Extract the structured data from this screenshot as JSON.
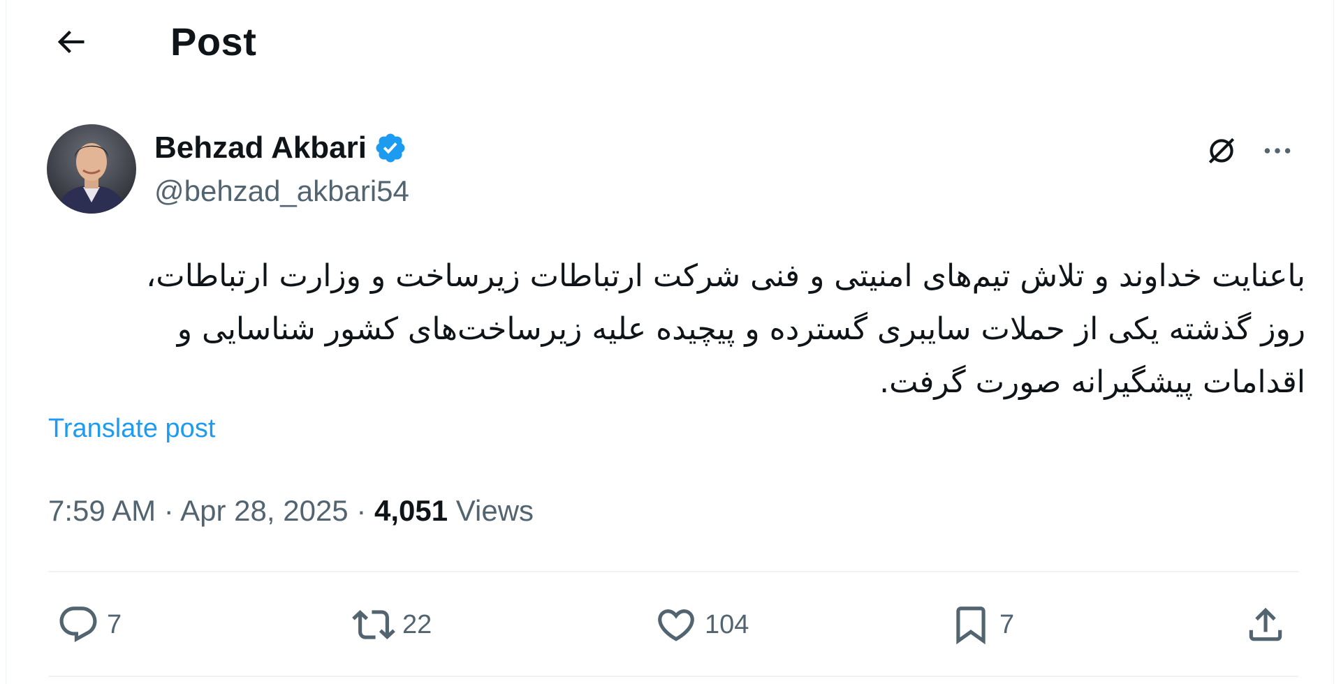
{
  "header": {
    "title": "Post",
    "back_icon": "arrow-left-icon"
  },
  "author": {
    "name": "Behzad Akbari",
    "handle": "@behzad_akbari54",
    "verified": true,
    "verified_color": "#1d9bf0",
    "avatar_icon": "profile-photo"
  },
  "post": {
    "text": "باعنایت خداوند و تلاش تیم‌های امنیتی و فنی شرکت ارتباطات زیرساخت و وزارت ارتباطات، روز گذشته یکی از حملات سایبری گسترده و پیچیده علیه زیرساخت‌های کشور شناسایی و اقدامات پیشگیرانه صورت گرفت.",
    "translate_label": "Translate post",
    "time": "7:59 AM",
    "separator": "·",
    "date": "Apr 28, 2025",
    "views_count": "4,051",
    "views_label": "Views"
  },
  "actions": {
    "replies": "7",
    "reposts": "22",
    "likes": "104",
    "bookmarks": "7"
  },
  "colors": {
    "accent": "#1d9bf0",
    "secondary_text": "#536471",
    "primary_text": "#0f1419",
    "divider": "#eff3f4"
  }
}
